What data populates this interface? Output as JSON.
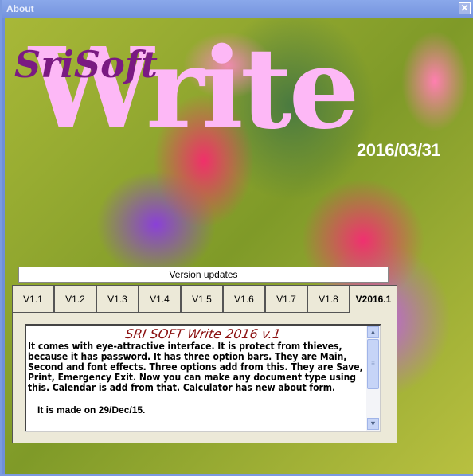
{
  "window": {
    "title": "About",
    "close": "✕"
  },
  "logo": {
    "brand": "SriSoft",
    "product": "Write",
    "date": "2016/03/31"
  },
  "version_bar": "Version updates",
  "tabs": [
    "V1.1",
    "V1.2",
    "V1.3",
    "V1.4",
    "V1.5",
    "V1.6",
    "V1.7",
    "V1.8",
    "V2016.1"
  ],
  "active_tab": "V2016.1",
  "content": {
    "heading": "SRI SOFT Write 2016 v.1",
    "body": "It comes with eye-attractive interface. It is protect from thieves, because it has password. It has three option bars. They are Main, Second and font effects. Three options add from this. They are Save, Print, Emergency Exit. Now you can make any document type using this. Calendar is add from that. Calculator has new about form.",
    "made": "It is made on 29/Dec/15."
  }
}
